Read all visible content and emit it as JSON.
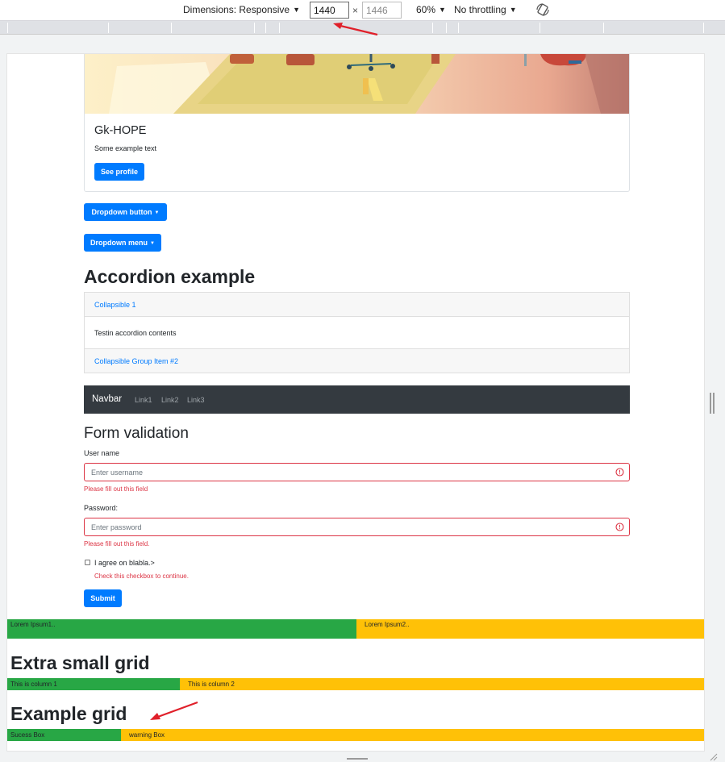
{
  "devtools": {
    "dimensions_label": "Dimensions: Responsive",
    "width_value": "1440",
    "height_value": "1446",
    "times_sign": "×",
    "zoom": "60%",
    "throttling": "No throttling"
  },
  "card": {
    "title": "Gk-HOPE",
    "text": "Some example text",
    "button_label": "See profile"
  },
  "dropdowns": {
    "button_label": "Dropdown button",
    "menu_label": "Dropdown menu"
  },
  "accordion": {
    "heading": "Accordion example",
    "items": [
      {
        "header": "Collapsible 1",
        "body": "Testin accordion contents"
      },
      {
        "header": "Collapsible Group Item #2"
      }
    ]
  },
  "navbar": {
    "brand": "Navbar",
    "links": [
      "Link1",
      "Link2",
      "Link3"
    ]
  },
  "form": {
    "heading": "Form validation",
    "username_label": "User name",
    "username_placeholder": "Enter username",
    "username_error": "Please fill out this field",
    "password_label": "Password:",
    "password_placeholder": "Enter password",
    "password_error": "Please fill out this field.",
    "checkbox_label": "I agree on blabla.>",
    "checkbox_error": "Check this checkbox to continue.",
    "submit_label": "Submit"
  },
  "grids": {
    "row1": [
      "Lorem Ipsum1..",
      "Lorem Ipsum2.."
    ],
    "extra_small_heading": "Extra small grid",
    "row2": [
      "This is column 1",
      "This is column 2"
    ],
    "example_heading": "Example grid",
    "row3": [
      "Sucess Box",
      "warning Box"
    ]
  },
  "colors": {
    "primary": "#007bff",
    "success": "#28a745",
    "warning": "#ffc107",
    "danger": "#dc3545",
    "dark": "#343a40",
    "annotation": "#e0202a"
  },
  "icons": [
    "rotate-icon",
    "error-icon",
    "annotation-arrow"
  ]
}
